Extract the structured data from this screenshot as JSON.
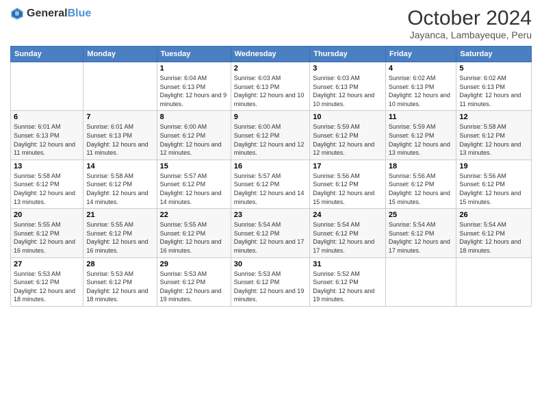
{
  "logo": {
    "text_general": "General",
    "text_blue": "Blue"
  },
  "title": {
    "month_year": "October 2024",
    "location": "Jayanca, Lambayeque, Peru"
  },
  "days_of_week": [
    "Sunday",
    "Monday",
    "Tuesday",
    "Wednesday",
    "Thursday",
    "Friday",
    "Saturday"
  ],
  "weeks": [
    [
      {
        "day": "",
        "info": ""
      },
      {
        "day": "",
        "info": ""
      },
      {
        "day": "1",
        "info": "Sunrise: 6:04 AM\nSunset: 6:13 PM\nDaylight: 12 hours and 9 minutes."
      },
      {
        "day": "2",
        "info": "Sunrise: 6:03 AM\nSunset: 6:13 PM\nDaylight: 12 hours and 10 minutes."
      },
      {
        "day": "3",
        "info": "Sunrise: 6:03 AM\nSunset: 6:13 PM\nDaylight: 12 hours and 10 minutes."
      },
      {
        "day": "4",
        "info": "Sunrise: 6:02 AM\nSunset: 6:13 PM\nDaylight: 12 hours and 10 minutes."
      },
      {
        "day": "5",
        "info": "Sunrise: 6:02 AM\nSunset: 6:13 PM\nDaylight: 12 hours and 11 minutes."
      }
    ],
    [
      {
        "day": "6",
        "info": "Sunrise: 6:01 AM\nSunset: 6:13 PM\nDaylight: 12 hours and 11 minutes."
      },
      {
        "day": "7",
        "info": "Sunrise: 6:01 AM\nSunset: 6:13 PM\nDaylight: 12 hours and 11 minutes."
      },
      {
        "day": "8",
        "info": "Sunrise: 6:00 AM\nSunset: 6:12 PM\nDaylight: 12 hours and 12 minutes."
      },
      {
        "day": "9",
        "info": "Sunrise: 6:00 AM\nSunset: 6:12 PM\nDaylight: 12 hours and 12 minutes."
      },
      {
        "day": "10",
        "info": "Sunrise: 5:59 AM\nSunset: 6:12 PM\nDaylight: 12 hours and 12 minutes."
      },
      {
        "day": "11",
        "info": "Sunrise: 5:59 AM\nSunset: 6:12 PM\nDaylight: 12 hours and 13 minutes."
      },
      {
        "day": "12",
        "info": "Sunrise: 5:58 AM\nSunset: 6:12 PM\nDaylight: 12 hours and 13 minutes."
      }
    ],
    [
      {
        "day": "13",
        "info": "Sunrise: 5:58 AM\nSunset: 6:12 PM\nDaylight: 12 hours and 13 minutes."
      },
      {
        "day": "14",
        "info": "Sunrise: 5:58 AM\nSunset: 6:12 PM\nDaylight: 12 hours and 14 minutes."
      },
      {
        "day": "15",
        "info": "Sunrise: 5:57 AM\nSunset: 6:12 PM\nDaylight: 12 hours and 14 minutes."
      },
      {
        "day": "16",
        "info": "Sunrise: 5:57 AM\nSunset: 6:12 PM\nDaylight: 12 hours and 14 minutes."
      },
      {
        "day": "17",
        "info": "Sunrise: 5:56 AM\nSunset: 6:12 PM\nDaylight: 12 hours and 15 minutes."
      },
      {
        "day": "18",
        "info": "Sunrise: 5:56 AM\nSunset: 6:12 PM\nDaylight: 12 hours and 15 minutes."
      },
      {
        "day": "19",
        "info": "Sunrise: 5:56 AM\nSunset: 6:12 PM\nDaylight: 12 hours and 15 minutes."
      }
    ],
    [
      {
        "day": "20",
        "info": "Sunrise: 5:55 AM\nSunset: 6:12 PM\nDaylight: 12 hours and 16 minutes."
      },
      {
        "day": "21",
        "info": "Sunrise: 5:55 AM\nSunset: 6:12 PM\nDaylight: 12 hours and 16 minutes."
      },
      {
        "day": "22",
        "info": "Sunrise: 5:55 AM\nSunset: 6:12 PM\nDaylight: 12 hours and 16 minutes."
      },
      {
        "day": "23",
        "info": "Sunrise: 5:54 AM\nSunset: 6:12 PM\nDaylight: 12 hours and 17 minutes."
      },
      {
        "day": "24",
        "info": "Sunrise: 5:54 AM\nSunset: 6:12 PM\nDaylight: 12 hours and 17 minutes."
      },
      {
        "day": "25",
        "info": "Sunrise: 5:54 AM\nSunset: 6:12 PM\nDaylight: 12 hours and 17 minutes."
      },
      {
        "day": "26",
        "info": "Sunrise: 5:54 AM\nSunset: 6:12 PM\nDaylight: 12 hours and 18 minutes."
      }
    ],
    [
      {
        "day": "27",
        "info": "Sunrise: 5:53 AM\nSunset: 6:12 PM\nDaylight: 12 hours and 18 minutes."
      },
      {
        "day": "28",
        "info": "Sunrise: 5:53 AM\nSunset: 6:12 PM\nDaylight: 12 hours and 18 minutes."
      },
      {
        "day": "29",
        "info": "Sunrise: 5:53 AM\nSunset: 6:12 PM\nDaylight: 12 hours and 19 minutes."
      },
      {
        "day": "30",
        "info": "Sunrise: 5:53 AM\nSunset: 6:12 PM\nDaylight: 12 hours and 19 minutes."
      },
      {
        "day": "31",
        "info": "Sunrise: 5:52 AM\nSunset: 6:12 PM\nDaylight: 12 hours and 19 minutes."
      },
      {
        "day": "",
        "info": ""
      },
      {
        "day": "",
        "info": ""
      }
    ]
  ]
}
